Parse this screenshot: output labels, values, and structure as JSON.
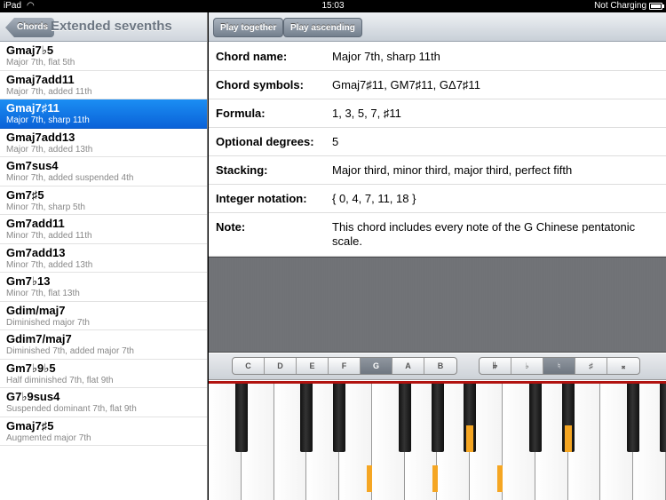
{
  "status": {
    "device": "iPad",
    "time": "15:03",
    "battery": "Not Charging"
  },
  "sidebar": {
    "back_label": "Chords",
    "title": "Extended sevenths",
    "items": [
      {
        "name": "Gmaj7♭5",
        "desc": "Major 7th, flat 5th"
      },
      {
        "name": "Gmaj7add11",
        "desc": "Major 7th, added 11th"
      },
      {
        "name": "Gmaj7♯11",
        "desc": "Major 7th, sharp 11th",
        "selected": true
      },
      {
        "name": "Gmaj7add13",
        "desc": "Major 7th, added 13th"
      },
      {
        "name": "Gm7sus4",
        "desc": "Minor 7th, added suspended 4th"
      },
      {
        "name": "Gm7♯5",
        "desc": "Minor 7th, sharp 5th"
      },
      {
        "name": "Gm7add11",
        "desc": "Minor 7th, added 11th"
      },
      {
        "name": "Gm7add13",
        "desc": "Minor 7th, added 13th"
      },
      {
        "name": "Gm7♭13",
        "desc": "Minor 7th, flat 13th"
      },
      {
        "name": "Gdim/maj7",
        "desc": "Diminished major 7th"
      },
      {
        "name": "Gdim7/maj7",
        "desc": "Diminished 7th, added major 7th"
      },
      {
        "name": "Gm7♭9♭5",
        "desc": "Half diminished 7th, flat 9th"
      },
      {
        "name": "G7♭9sus4",
        "desc": "Suspended dominant 7th, flat 9th"
      },
      {
        "name": "Gmaj7♯5",
        "desc": "Augmented major 7th"
      }
    ]
  },
  "toolbar": {
    "play_together": "Play together",
    "play_ascending": "Play ascending"
  },
  "details": [
    {
      "key": "Chord name:",
      "value": "Major 7th, sharp 11th"
    },
    {
      "key": "Chord symbols:",
      "value": "Gmaj7♯11, GM7♯11, GΔ7♯11"
    },
    {
      "key": "Formula:",
      "value": "1, 3, 5, 7, ♯11"
    },
    {
      "key": "Optional degrees:",
      "value": "5"
    },
    {
      "key": "Stacking:",
      "value": "Major third, minor third, major third, perfect fifth"
    },
    {
      "key": "Integer notation:",
      "value": "{ 0, 4, 7, 11, 18 }"
    },
    {
      "key": "Note:",
      "value": "This chord includes every note of the G Chinese pentatonic scale."
    }
  ],
  "root_selector": {
    "options": [
      "C",
      "D",
      "E",
      "F",
      "G",
      "A",
      "B"
    ],
    "selected": "G"
  },
  "accidental_selector": {
    "options": [
      "𝄫",
      "♭",
      "♮",
      "♯",
      "𝄪"
    ],
    "selected": "♮"
  },
  "piano": {
    "white_keys": 14,
    "highlighted_white_key_indices": [
      4,
      6,
      8
    ],
    "highlighted_black_key_indices": [
      5,
      7
    ]
  },
  "colors": {
    "selection": "#0a62d8",
    "highlight": "#f5a623",
    "piano_felt": "#6d6f73",
    "keyboard_line": "#b1120f"
  }
}
